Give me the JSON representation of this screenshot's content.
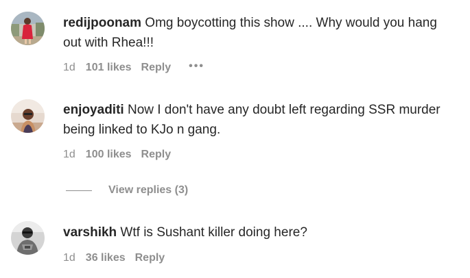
{
  "comments": [
    {
      "username": "redijpoonam",
      "text": " Omg boycotting this show .... Why would you hang out with Rhea!!!",
      "time": "1d",
      "likes": "101 likes",
      "reply": "Reply",
      "more": "•••",
      "avatar_icon": "avatar-woman-red-dress"
    },
    {
      "username": "enjoyaditi",
      "text": " Now I don't have any doubt left regarding SSR murder being linked to KJo n gang.",
      "time": "1d",
      "likes": "100 likes",
      "reply": "Reply",
      "avatar_icon": "avatar-woman-sunglasses"
    },
    {
      "username": "varshikh",
      "text": " Wtf is Sushant killer doing here?",
      "time": "1d",
      "likes": "36 likes",
      "reply": "Reply",
      "avatar_icon": "avatar-man-grayscale"
    }
  ],
  "view_replies": "View replies (3)",
  "colors": {
    "text": "#262626",
    "secondary": "#8e8e8e"
  }
}
